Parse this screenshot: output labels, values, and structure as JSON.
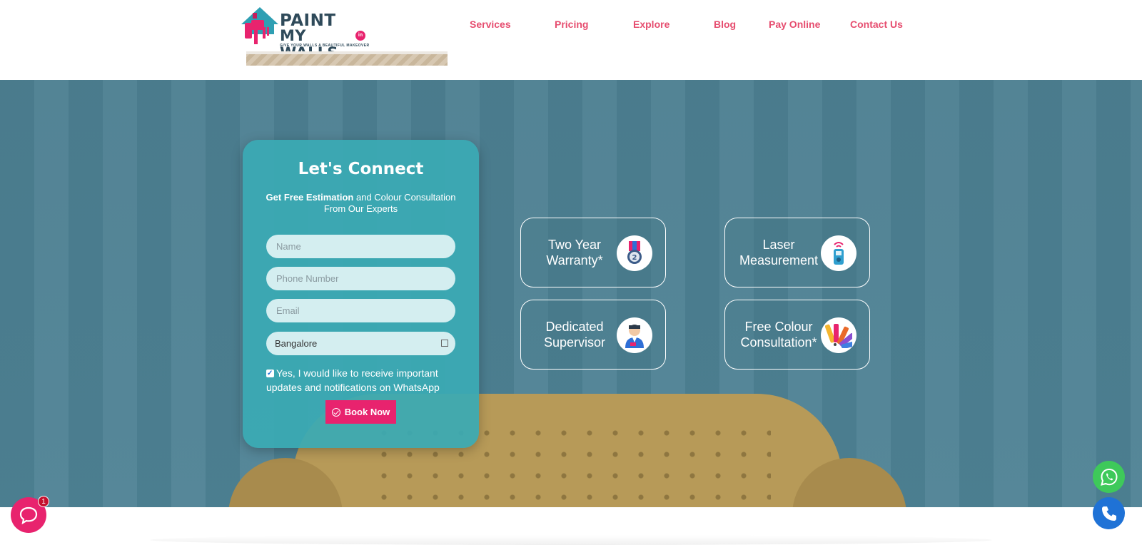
{
  "brand": {
    "line1": "PAINT",
    "line2": "MY WALLS.",
    "domain_badge": "in",
    "tagline": "GIVE YOUR WALLS A BEAUTIFUL MAKEOVER",
    "colors": {
      "pink": "#e8236e",
      "navy": "#2f4a5a",
      "teal": "#3aaab4"
    }
  },
  "nav": {
    "items": [
      {
        "label": "Services"
      },
      {
        "label": "Pricing"
      },
      {
        "label": "Explore"
      },
      {
        "label": "Blog"
      },
      {
        "label": "Pay Online"
      },
      {
        "label": "Contact Us"
      }
    ],
    "color": "#e64d6f"
  },
  "form": {
    "title": "Let's Connect",
    "subtitle_bold": "Get Free Estimation",
    "subtitle_rest": " and Colour Consultation From Our Experts",
    "name_placeholder": "Name",
    "phone_placeholder": "Phone Number",
    "email_placeholder": "Email",
    "city_value": "Bangalore",
    "consent_text": "Yes, I would like to receive important updates and notifications on WhatsApp",
    "consent_checked": true,
    "submit_label": "Book Now"
  },
  "features": [
    {
      "label": "Two Year Warranty*",
      "icon": "medal-icon"
    },
    {
      "label": "Laser Measurement",
      "icon": "laser-meter-icon"
    },
    {
      "label": "Dedicated Supervisor",
      "icon": "supervisor-icon"
    },
    {
      "label": "Free Colour Consultation*",
      "icon": "colour-swatch-icon"
    }
  ],
  "widgets": {
    "chat_badge": "1",
    "chat_icon": "chat-icon",
    "whatsapp_icon": "whatsapp-icon",
    "phone_icon": "phone-icon"
  }
}
